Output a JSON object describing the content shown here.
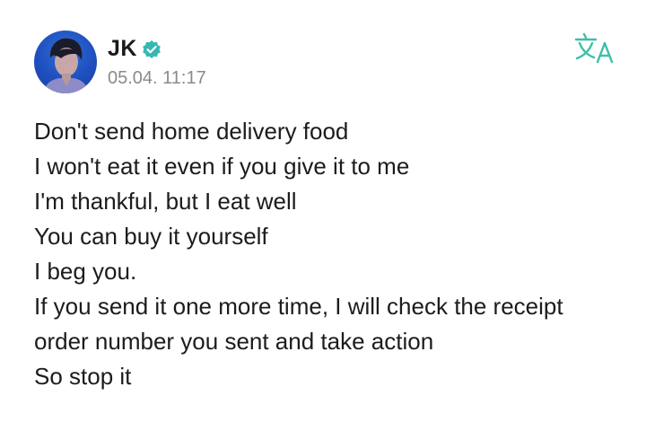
{
  "author": {
    "name": "JK",
    "verified": true,
    "verified_color": "#35b8b0",
    "timestamp": "05.04. 11:17"
  },
  "toolbar": {
    "translate_icon": "translate-icon",
    "translate_color": "#3cbfa8"
  },
  "post": {
    "lines": [
      "Don't send home delivery food",
      "I won't eat it even if you give it to me",
      "I'm thankful, but I eat well",
      "You can buy it yourself",
      "I beg you.",
      "If you send it one more time, I will check the receipt",
      "order number you sent and take action",
      "So stop it"
    ]
  }
}
